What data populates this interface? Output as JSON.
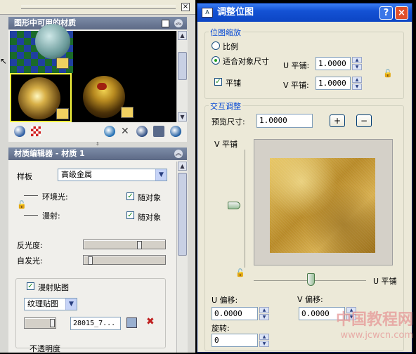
{
  "left_panel": {
    "available_materials": {
      "title": "图形中可用的材质"
    },
    "toolbar_icons": [
      "sphere-icon",
      "checker-icon",
      "create-new-icon",
      "purge-icon",
      "apply-icon",
      "tool-icon",
      "globe-icon"
    ],
    "material_editor": {
      "title": "材质编辑器 - 材质 1",
      "template_label": "样板",
      "template_value": "高级金属",
      "ambient_label": "环境光:",
      "ambient_check": "随对象",
      "diffuse_label": "漫射:",
      "diffuse_check": "随对象",
      "reflectivity_label": "反光度:",
      "self_illum_label": "自发光:",
      "diffuse_map_label": "漫射贴图",
      "map_type": "纹理贴图",
      "map_file": "28015_7...",
      "opacity_label": "不透明度"
    }
  },
  "dialog": {
    "title": "调整位图",
    "help": "?",
    "close": "×",
    "scaling": {
      "group_label": "位图缩放",
      "option_scale": "比例",
      "option_fit": "适合对象尺寸",
      "tile_label": "平铺",
      "u_tile_label": "U 平铺:",
      "u_tile_value": "1.0000",
      "v_tile_label": "V 平铺:",
      "v_tile_value": "1.0000"
    },
    "interactive": {
      "group_label": "交互调整",
      "preview_size_label": "预览尺寸:",
      "preview_size_value": "1.0000",
      "plus": "+",
      "minus": "−",
      "v_tile_axis": "V 平铺",
      "u_tile_axis": "U 平铺",
      "u_offset_label": "U 偏移:",
      "u_offset_value": "0.0000",
      "v_offset_label": "V 偏移:",
      "v_offset_value": "0.0000",
      "rotation_label": "旋转:",
      "rotation_value": "0"
    }
  },
  "watermark": {
    "line1": "中国教程网",
    "line2": "www.jcwcn.com"
  },
  "colors": {
    "dialog_title": "#1452d4",
    "group_label": "#0046d5",
    "panel_title": "#6a7894"
  }
}
